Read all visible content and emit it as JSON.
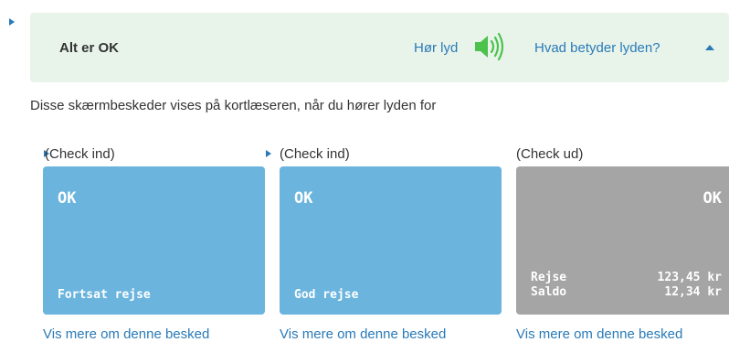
{
  "status": {
    "title": "Alt er OK",
    "hear_label": "Hør lyd",
    "meaning_label": "Hvad betyder lyden?"
  },
  "description": "Disse skærmbeskeder vises på kortlæseren, når du hører lyden for",
  "cards": [
    {
      "label": "(Check ind)",
      "ok": "OK",
      "bottom_text": "Fortsat rejse",
      "color": "#6ab4de",
      "link": "Vis mere om denne besked"
    },
    {
      "label": "(Check ind)",
      "ok": "OK",
      "bottom_text": "God rejse",
      "color": "#6ab4de",
      "link": "Vis mere om denne besked"
    },
    {
      "label": "(Check ud)",
      "ok": "OK",
      "rows": [
        {
          "name": "Rejse",
          "value": "123,45 kr"
        },
        {
          "name": "Saldo",
          "value": "12,34 kr"
        }
      ],
      "color": "#a5a5a5",
      "link": "Vis mere om denne besked"
    }
  ],
  "colors": {
    "accent": "#2a7ab8",
    "status_background": "#e8f4ea",
    "speaker": "#4cc24c"
  },
  "icons": [
    "expand-arrow-icon",
    "speaker-icon",
    "caret-up-icon"
  ]
}
